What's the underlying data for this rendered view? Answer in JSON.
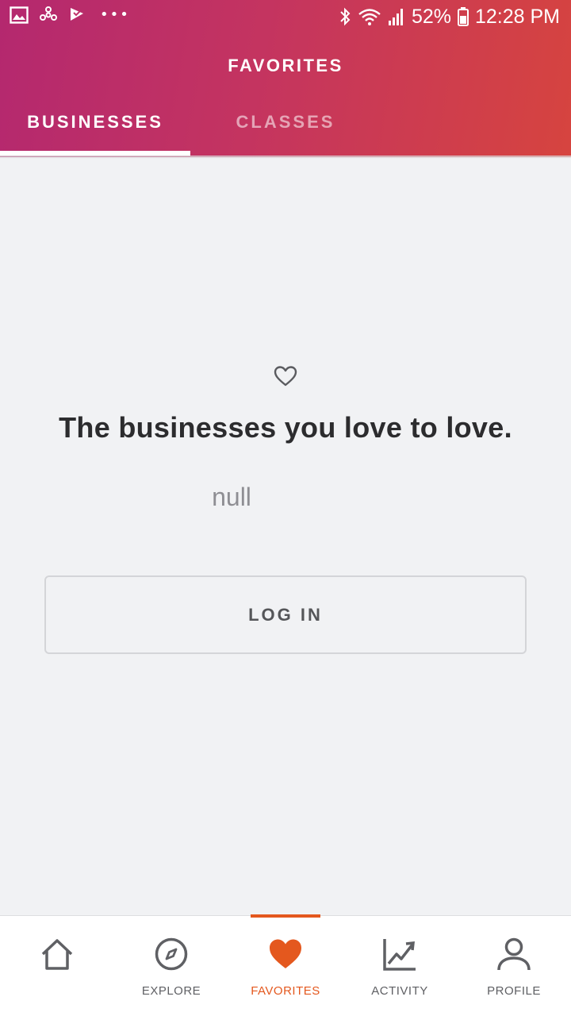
{
  "status_bar": {
    "battery": "52%",
    "time": "12:28 PM",
    "icons": [
      "gallery-icon",
      "fan-icon",
      "flag-icon",
      "more-icon",
      "bluetooth-icon",
      "wifi-icon",
      "signal-icon",
      "battery-icon"
    ]
  },
  "header": {
    "title": "FAVORITES",
    "tabs": [
      {
        "label": "BUSINESSES",
        "active": true
      },
      {
        "label": "CLASSES",
        "active": false
      }
    ],
    "gradient_start": "#b4286f",
    "gradient_end": "#d6443f"
  },
  "empty_state": {
    "icon": "heart-outline-icon",
    "headline": "The businesses you love to love.",
    "subtext": "null",
    "login_button": "LOG IN"
  },
  "bottom_nav": {
    "accent_color": "#e4581e",
    "items": [
      {
        "label": "",
        "icon": "home-icon",
        "active": false
      },
      {
        "label": "EXPLORE",
        "icon": "compass-icon",
        "active": false
      },
      {
        "label": "FAVORITES",
        "icon": "heart-icon",
        "active": true
      },
      {
        "label": "ACTIVITY",
        "icon": "chart-icon",
        "active": false
      },
      {
        "label": "PROFILE",
        "icon": "person-icon",
        "active": false
      }
    ]
  }
}
